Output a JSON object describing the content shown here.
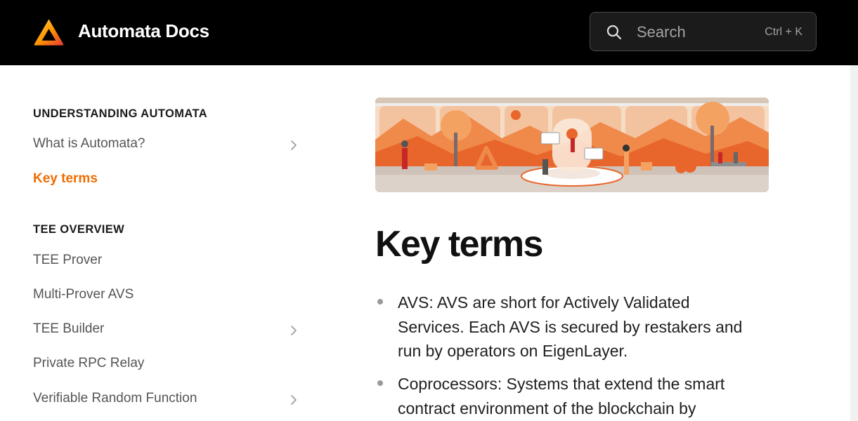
{
  "header": {
    "brand": "Automata Docs",
    "search_placeholder": "Search",
    "search_shortcut": "Ctrl + K"
  },
  "sidebar": {
    "sections": [
      {
        "title": "UNDERSTANDING AUTOMATA",
        "items": [
          {
            "label": "What is Automata?",
            "expandable": true,
            "active": false
          },
          {
            "label": "Key terms",
            "expandable": false,
            "active": true
          }
        ]
      },
      {
        "title": "TEE OVERVIEW",
        "items": [
          {
            "label": "TEE Prover",
            "expandable": false,
            "active": false
          },
          {
            "label": "Multi-Prover AVS",
            "expandable": false,
            "active": false
          },
          {
            "label": "TEE Builder",
            "expandable": true,
            "active": false
          },
          {
            "label": "Private RPC Relay",
            "expandable": false,
            "active": false
          },
          {
            "label": "Verifiable Random Function",
            "expandable": true,
            "active": false
          }
        ]
      }
    ]
  },
  "main": {
    "title": "Key terms",
    "terms": [
      {
        "lines": [
          "AVS: AVS are short for Actively Validated",
          "Services. Each AVS is secured by restakers and",
          "run by operators on EigenLayer."
        ]
      },
      {
        "lines": [
          "Coprocessors: Systems that extend the smart",
          "contract environment of the blockchain by"
        ]
      }
    ]
  },
  "theme": {
    "accent": "#ef6c00",
    "header_bg": "#000000",
    "text": "#1f1f1f",
    "muted": "#555555"
  },
  "icons": {
    "logo": "automata-logo-icon",
    "search": "search-icon",
    "chevron": "chevron-right-icon"
  }
}
